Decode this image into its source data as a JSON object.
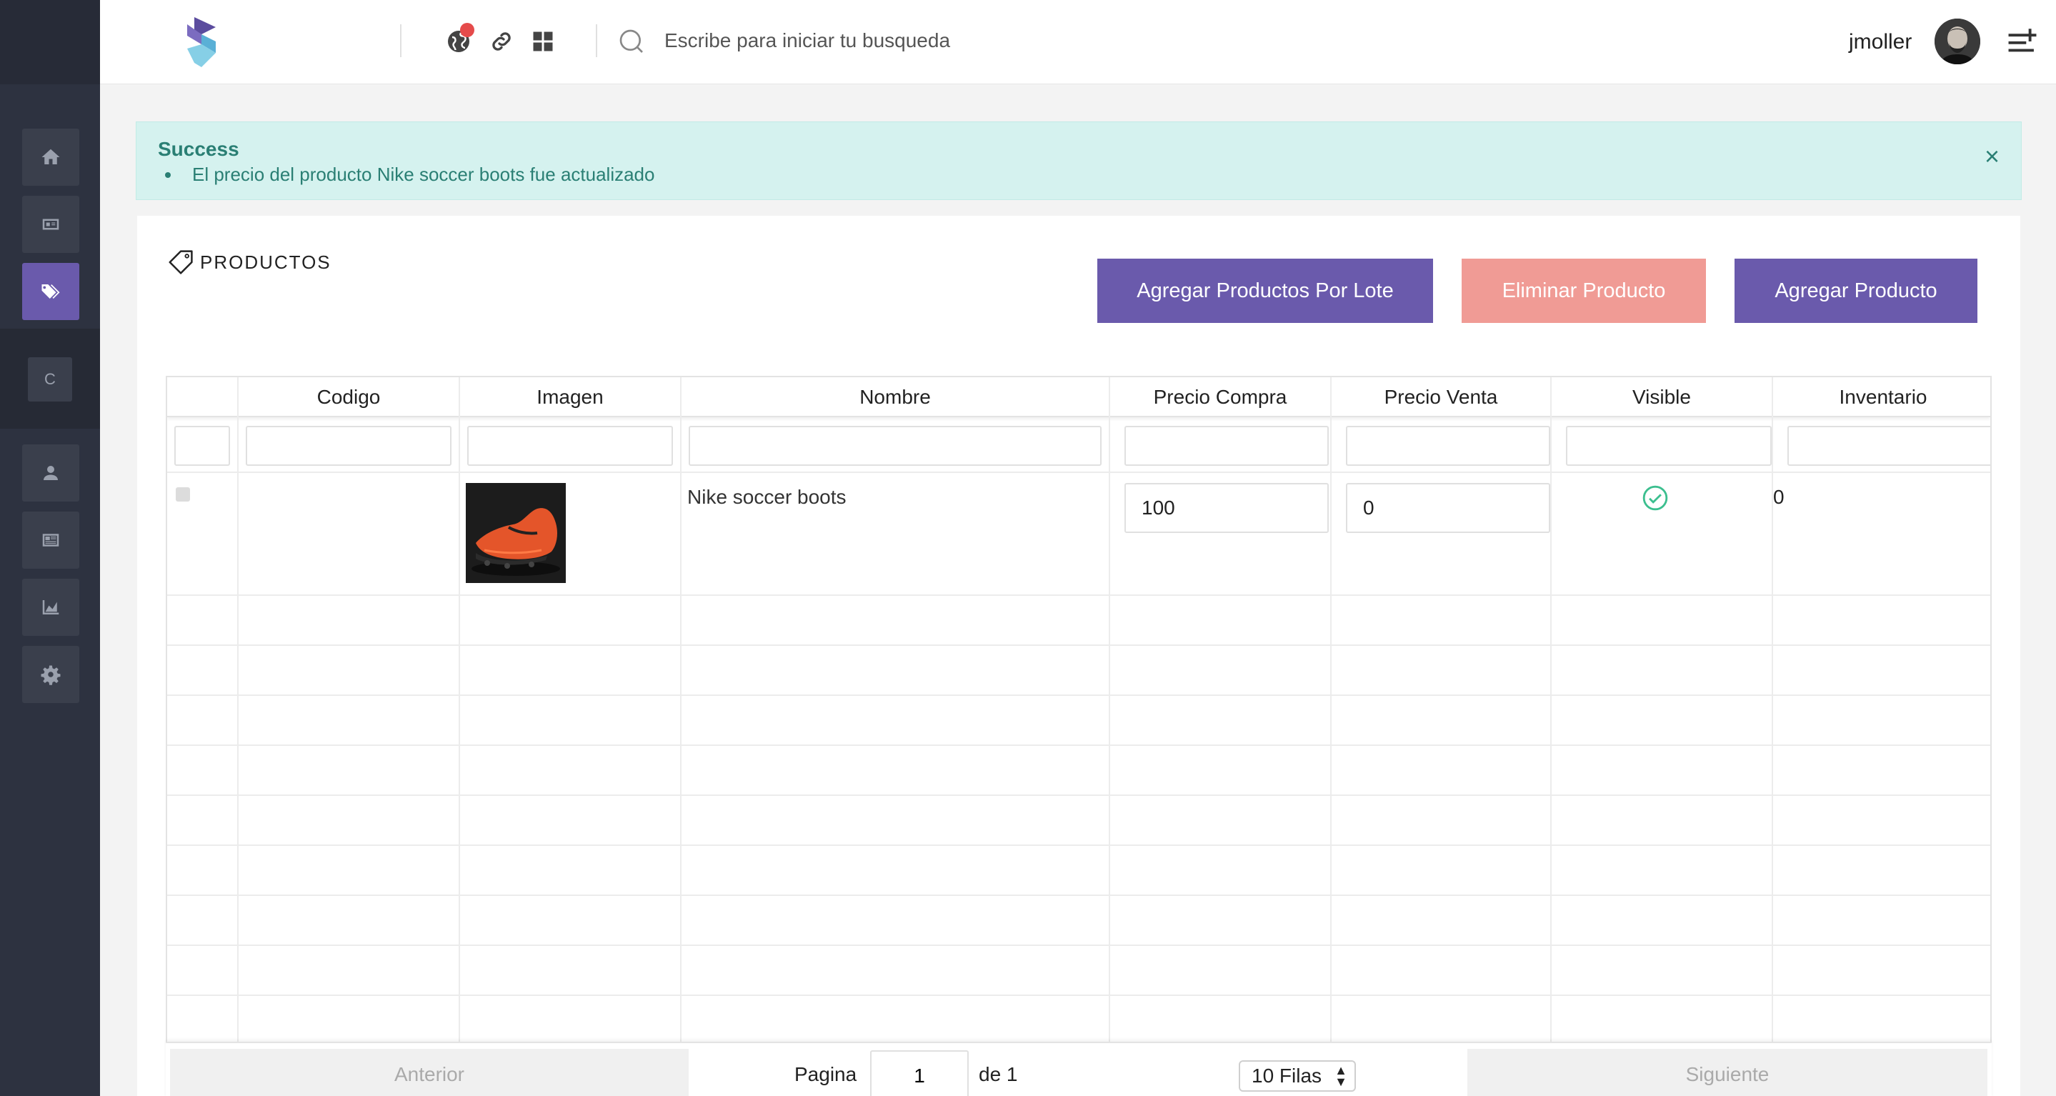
{
  "header": {
    "search_placeholder": "Escribe para iniciar tu busqueda",
    "username": "jmoller"
  },
  "sidebar": {
    "items": [
      {
        "icon": "home-icon"
      },
      {
        "icon": "panel-icon"
      },
      {
        "icon": "tags-icon",
        "active": true
      },
      {
        "label": "C"
      },
      {
        "icon": "user-icon"
      },
      {
        "icon": "newspaper-icon"
      },
      {
        "icon": "area-chart-icon"
      },
      {
        "icon": "gear-icon"
      }
    ]
  },
  "alert": {
    "title": "Success",
    "message": "El precio del producto Nike soccer boots fue actualizado",
    "close": "×"
  },
  "page": {
    "title": "PRODUCTOS",
    "buttons": {
      "add_batch": "Agregar Productos Por Lote",
      "delete": "Eliminar Producto",
      "add": "Agregar Producto"
    }
  },
  "table": {
    "columns": [
      "",
      "Codigo",
      "Imagen",
      "Nombre",
      "Precio Compra",
      "Precio Venta",
      "Visible",
      "Inventario"
    ],
    "rows": [
      {
        "codigo": "",
        "nombre": "Nike soccer boots",
        "precio_compra": "100",
        "precio_venta": "0",
        "visible": true,
        "inventario": "0"
      }
    ]
  },
  "pagination": {
    "prev": "Anterior",
    "page_label": "Pagina",
    "page": "1",
    "of_label": "de 1",
    "rows_option": "10 Filas",
    "next": "Siguiente"
  },
  "colors": {
    "primary": "#6a5aac",
    "danger_light": "#f09b95",
    "success_bg": "#d5f2ef",
    "success_text": "#2a7f74",
    "sidebar_bg": "#2d3240"
  }
}
